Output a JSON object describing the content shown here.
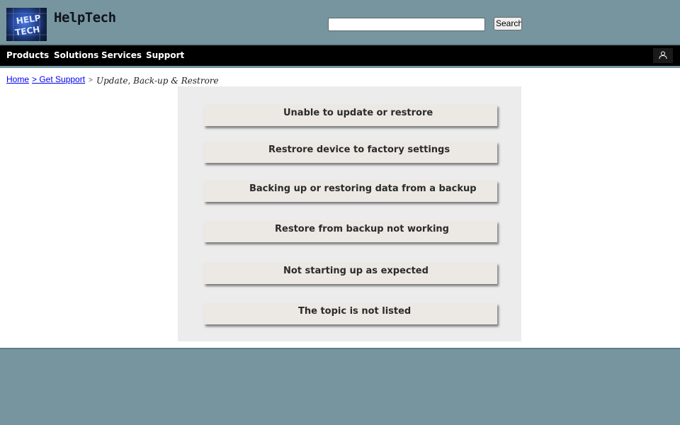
{
  "header": {
    "brand": "HelpTech",
    "search": {
      "value": "",
      "placeholder": "",
      "button_label": "Search"
    },
    "colors": {
      "header_bg": "#76959f",
      "navbar_bg": "#000000",
      "footer_bg": "#76959f",
      "panel_bg": "#ececec",
      "topic_bg": "#ece9e4"
    }
  },
  "nav": {
    "items": [
      {
        "label": "Products"
      },
      {
        "label": "Solutions"
      },
      {
        "label": "Services"
      },
      {
        "label": "Support"
      }
    ],
    "account_icon": "user-icon"
  },
  "breadcrumb": {
    "home": "Home",
    "parent": "> Get Support",
    "separator": ">",
    "current": "Update, Back-up & Restrore"
  },
  "topics": [
    {
      "label": "Unable to update or restrore"
    },
    {
      "label": "Restrore device to factory settings"
    },
    {
      "label": "Backing up or restoring data from a backup"
    },
    {
      "label": "Restore from backup not working"
    },
    {
      "label": "Not starting up as expected"
    },
    {
      "label": "The topic is not listed"
    }
  ]
}
